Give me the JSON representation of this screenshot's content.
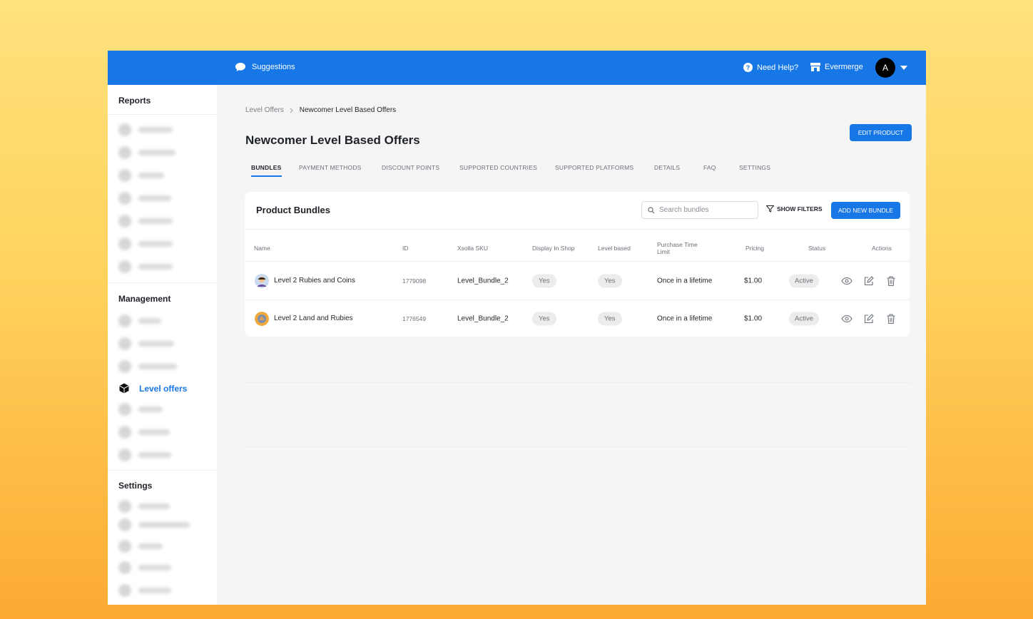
{
  "topbar": {
    "suggestions_label": "Suggestions",
    "help_label": "Need Help?",
    "store_label": "Evermerge",
    "avatar_letter": "A",
    "bar_color": "#1877e6"
  },
  "sidebar": {
    "reports_title": "Reports",
    "management_title": "Management",
    "settings_title": "Settings",
    "active_item_label": "Level offers",
    "active_item_icon": "cube-icon"
  },
  "breadcrumb": {
    "parent": "Level Offers",
    "current": "Newcomer Level Based Offers"
  },
  "page": {
    "title": "Newcomer Level Based Offers",
    "edit_button": "EDIT PRODUCT"
  },
  "tabs": [
    {
      "label": "BUNDLES",
      "active": true
    },
    {
      "label": "PAYMENT METHODS"
    },
    {
      "label": "DISCOUNT POINTS"
    },
    {
      "label": "SUPPORTED COUNTRIES"
    },
    {
      "label": "SUPPORTED PLATFORMS"
    },
    {
      "label": "DETAILS"
    },
    {
      "label": "FAQ"
    },
    {
      "label": "SETTINGS"
    }
  ],
  "bundles": {
    "title": "Product Bundles",
    "search_placeholder": "Search bundles",
    "filters_label": "SHOW FILTERS",
    "add_button": "ADD NEW BUNDLE",
    "columns": {
      "name": "Name",
      "id": "ID",
      "sku": "Xsolla SKU",
      "display": "Display In Shop",
      "level": "Level based",
      "purchase_1": "Purchase Time",
      "purchase_2": "Limit",
      "pricing": "Pricing",
      "status": "Status",
      "actions": "Actions"
    },
    "rows": [
      {
        "name": "Level 2 Rubies and Coins",
        "id": "1779098",
        "sku": "Level_Bundle_2",
        "display": "Yes",
        "level": "Yes",
        "limit": "Once in a lifetime",
        "price": "$1.00",
        "status": "Active"
      },
      {
        "name": "Level 2 Land and Rubies",
        "id": "1776549",
        "sku": "Level_Bundle_2",
        "display": "Yes",
        "level": "Yes",
        "limit": "Once in a lifetime",
        "price": "$1.00",
        "status": "Active"
      }
    ]
  }
}
